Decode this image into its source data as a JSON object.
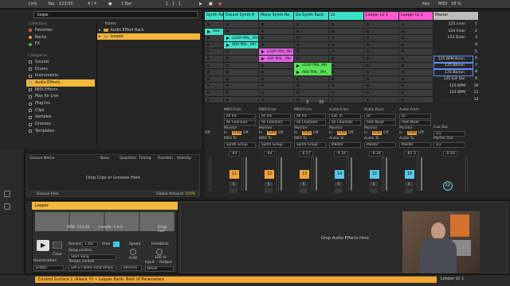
{
  "topbar": {
    "link": "Link",
    "tap": "Tap",
    "tempo": "123.00",
    "time_sig": "4 / 4",
    "quantize": "1 Bar",
    "position": "1 .  1 .  1",
    "key": "Key",
    "midi": "MIDI",
    "cpu": "18 %"
  },
  "browser": {
    "search_value": "looper",
    "collections_header": "Collections",
    "collections": [
      {
        "label": "Favoriten",
        "color": "#e85050"
      },
      {
        "label": "Racks",
        "color": "#e89a3c"
      },
      {
        "label": "FX",
        "color": "#4fb04f"
      }
    ],
    "categories_header": "Categories",
    "categories": [
      {
        "label": "Sounds",
        "selected": false
      },
      {
        "label": "Drums",
        "selected": false
      },
      {
        "label": "Instruments",
        "selected": false
      },
      {
        "label": "Audio Effects",
        "selected": true
      },
      {
        "label": "MIDI Effects",
        "selected": false
      },
      {
        "label": "Max for Live",
        "selected": false
      },
      {
        "label": "Plug-Ins",
        "selected": false
      },
      {
        "label": "Clips",
        "selected": false
      },
      {
        "label": "Samples",
        "selected": false
      },
      {
        "label": "Grooves",
        "selected": false
      },
      {
        "label": "Templates",
        "selected": false
      }
    ],
    "content_header": "Name",
    "content_items": [
      {
        "label": "Audio Effect Rack",
        "selected": false
      },
      {
        "label": "Looper",
        "selected": true
      }
    ]
  },
  "groove": {
    "columns": [
      "Groove Name",
      "Base",
      "Quantize",
      "Timing",
      "Random",
      "Velocity"
    ],
    "empty_text": "Drop Clips or Grooves Here",
    "pool_label": "Groove Pool",
    "global_amount_label": "Global Amount",
    "global_amount_value": "100%"
  },
  "session": {
    "tracks": [
      {
        "name": "Synth Rack",
        "color": "#3ee0c8"
      },
      {
        "name": "Dream Synth R",
        "color": "#3ee0c8"
      },
      {
        "name": "Mono Synth Ra",
        "color": "#3ee0c8"
      },
      {
        "name": "Go Synth Rack",
        "color": "#3ee0c8"
      },
      {
        "name": "LV",
        "color": "#3ee0c8"
      },
      {
        "name": "Looper LV 1",
        "color": "#ff5ad2"
      },
      {
        "name": "Looper LV 1",
        "color": "#ff5ad2"
      },
      {
        "name": "Master",
        "color": "#bdbdbd"
      }
    ],
    "clips": [
      {
        "label": "LOOP PML_ MH",
        "color": "#3ee0c8"
      },
      {
        "label": "ARR PML_ MH",
        "color": "#3ee0c8"
      },
      {
        "label": "LOOP PML_MH",
        "color": "#e265e8"
      },
      {
        "label": "ARR PML_ MH",
        "color": "#e265e8"
      },
      {
        "label": "LOOP PML_MH",
        "color": "#57e357"
      },
      {
        "label": "ARR PML_ MH_",
        "color": "#57e357"
      },
      {
        "label": "Saw",
        "color": "#3ee0c8"
      }
    ],
    "scenes": [
      {
        "label": "125 cmin",
        "num": "1"
      },
      {
        "label": "124 Fmin",
        "num": "2"
      },
      {
        "label": "122 Gmin",
        "num": "3"
      },
      {
        "label": "",
        "num": "4"
      },
      {
        "label": "",
        "num": "5"
      },
      {
        "label": "125 BPM Bmin",
        "num": "6"
      },
      {
        "label": "125 Bbmin",
        "num": "7"
      },
      {
        "label": "125 Bbmin",
        "num": "8"
      },
      {
        "label": "125 G# Dor",
        "num": "9"
      },
      {
        "label": "125 BPM",
        "num": "10"
      },
      {
        "label": "122 BPM",
        "num": "11"
      },
      {
        "label": "",
        "num": "12"
      }
    ],
    "counters": [
      "3",
      "32"
    ],
    "io": {
      "midi_from": "MIDI From",
      "audio_from": "Audio From",
      "all_ins": "All Ins",
      "ext_in": "Ext. In",
      "all_channels": "All Channels",
      "post_mixer": "Post Mixer",
      "lv": "LV",
      "monitor": "Monitor",
      "in": "In",
      "auto": "Auto",
      "off": "Off",
      "midi_to": "MIDI To",
      "audio_to": "Audio To",
      "synth_group": "Synth Group",
      "master": "Master",
      "cue_out": "Cue Out",
      "cue_value": "1/2",
      "master_out": "Master Out",
      "master_value": "1/2"
    },
    "volumes": [
      "-Inf",
      "-Inf",
      "-6.57",
      "-9.34",
      "-9.34",
      "-81.3",
      "-0.50"
    ],
    "track_numbers": [
      "11",
      "12",
      "13",
      "14",
      "15",
      "16"
    ],
    "track_number_colors": [
      "#f3a537",
      "#f3a537",
      "#f3a537",
      "#5ac8e8",
      "#5ac8e8",
      "#5ac8e8"
    ],
    "master_num": "12"
  },
  "device": {
    "title": "Looper",
    "bpm": "BPM: 123.00",
    "length": "Length: 1.0.0",
    "drag_label": "Drag me!",
    "clear_label": "Clear",
    "record_label": "Record",
    "record_value": "1 bar",
    "then_label": "then",
    "song_control_label": "Song control",
    "song_control_value": "Start Song",
    "tempo_control_label": "Tempo control",
    "tempo_control_value": "Set & Follow song tempo",
    "speed_label": "Speed",
    "speed_value": "0.00",
    "reverse_label": "Reverse",
    "feedback_label": "Feedback",
    "feedback_value": "100 %",
    "input_label": "Input",
    "output_label": "Output",
    "output_value": "Never",
    "quantization_label": "Quantization",
    "quantization_value": "Global",
    "drop_fx": "Drop Audio Effects Here"
  },
  "status": {
    "message": "Control Surface 1 (Alesis_V) » Looper Bank: Best of Parameters",
    "track": "Looper LV 1"
  }
}
